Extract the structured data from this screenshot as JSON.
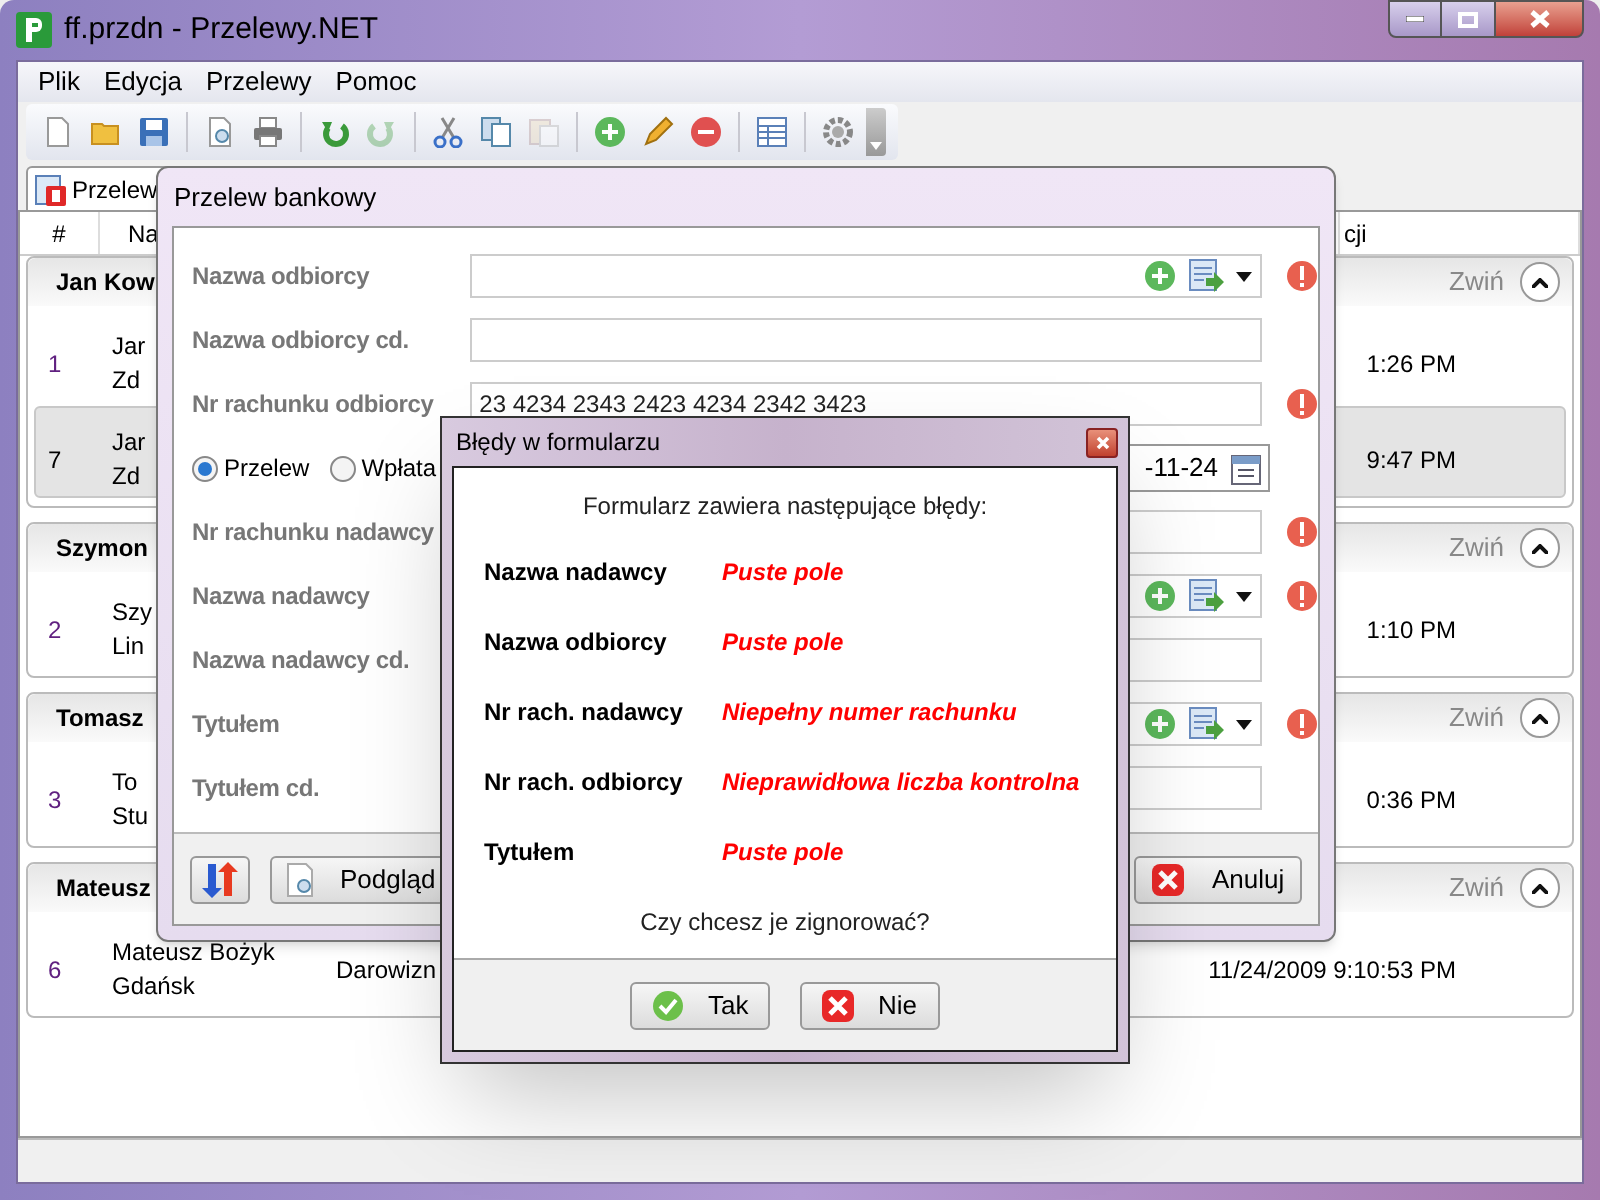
{
  "window": {
    "title": "ff.przdn - Przelewy.NET"
  },
  "menu": [
    "Plik",
    "Edycja",
    "Przelewy",
    "Pomoc"
  ],
  "toolbar": [
    [
      {
        "kind": "new",
        "disabled": false
      },
      {
        "kind": "open",
        "disabled": false
      },
      {
        "kind": "save",
        "disabled": false
      }
    ],
    [
      {
        "kind": "preview",
        "disabled": false
      },
      {
        "kind": "print",
        "disabled": false
      }
    ],
    [
      {
        "kind": "undo",
        "disabled": false
      },
      {
        "kind": "redo",
        "disabled": true
      }
    ],
    [
      {
        "kind": "cut",
        "disabled": false
      },
      {
        "kind": "copy",
        "disabled": false
      },
      {
        "kind": "paste",
        "disabled": true
      }
    ],
    [
      {
        "kind": "add",
        "disabled": false
      },
      {
        "kind": "edit",
        "disabled": false
      },
      {
        "kind": "remove",
        "disabled": false
      }
    ],
    [
      {
        "kind": "table",
        "disabled": false
      }
    ],
    [
      {
        "kind": "settings",
        "disabled": false
      }
    ]
  ],
  "tabs": [
    {
      "label": "Przelew",
      "selected": true
    }
  ],
  "list": {
    "columns": [
      "#",
      "Na",
      "cji"
    ],
    "groups": [
      {
        "header": "Jan Kow",
        "collapse_label": "Zwiń",
        "rows": [
          {
            "number": "1",
            "name": "Jar",
            "city": "Zd",
            "time": "1:26 PM",
            "selected": false
          },
          {
            "number": "7",
            "name": "Jar",
            "city": "Zd",
            "time": "9:47 PM",
            "selected": true
          }
        ]
      },
      {
        "header": "Szymon",
        "collapse_label": "Zwiń",
        "rows": [
          {
            "number": "2",
            "name": "Szy",
            "city": "Lin",
            "time": "1:10 PM",
            "selected": false
          }
        ]
      },
      {
        "header": "Tomasz",
        "collapse_label": "Zwiń",
        "rows": [
          {
            "number": "3",
            "name": "To",
            "city": "Stu",
            "time": "0:36 PM",
            "selected": false
          }
        ]
      },
      {
        "header": "Mateusz",
        "collapse_label": "Zwiń",
        "rows": [
          {
            "number": "6",
            "name": "Mateusz Bożyk",
            "city": "Gdańsk",
            "type": "Darowizn",
            "time": "11/24/2009 9:10:53 PM",
            "selected": false
          }
        ]
      }
    ]
  },
  "transfer_dialog": {
    "title": "Przelew bankowy",
    "fields_top": [
      {
        "label": "Nazwa odbiorcy",
        "kind": "combo",
        "error": true
      },
      {
        "label": "Nazwa odbiorcy cd.",
        "kind": "text",
        "error": false
      },
      {
        "label": "Nr rachunku odbiorcy",
        "kind": "text",
        "value": "23 4234 2343 2423 4234 2342 3423",
        "error": true
      }
    ],
    "payment_type": [
      {
        "label": "Przelew",
        "selected": true
      },
      {
        "label": "Wpłata",
        "selected": false
      }
    ],
    "date": "-11-24",
    "fields_bottom": [
      {
        "label": "Nr rachunku nadawcy",
        "kind": "text",
        "error": true
      },
      {
        "label": "Nazwa nadawcy",
        "kind": "combo",
        "error": true
      },
      {
        "label": "Nazwa nadawcy cd.",
        "kind": "text",
        "error": false
      },
      {
        "label": "Tytułem",
        "kind": "combo",
        "error": true
      },
      {
        "label": "Tytułem cd.",
        "kind": "text",
        "error": false
      }
    ],
    "buttons": [
      {
        "kind": "swap"
      },
      {
        "kind": "preview",
        "label": "Podgląd"
      },
      {
        "kind": "cancel",
        "label": "Anuluj"
      }
    ]
  },
  "error_dialog": {
    "title": "Błędy w formularzu",
    "intro": "Formularz zawiera następujące błędy:",
    "errors": [
      {
        "field": "Nazwa nadawcy",
        "message": "Puste pole"
      },
      {
        "field": "Nazwa odbiorcy",
        "message": "Puste pole"
      },
      {
        "field": "Nr rach. nadawcy",
        "message": "Niepełny numer rachunku"
      },
      {
        "field": "Nr rach. odbiorcy",
        "message": "Nieprawidłowa liczba kontrolna"
      },
      {
        "field": "Tytułem",
        "message": "Puste pole"
      }
    ],
    "question": "Czy chcesz je zignorować?",
    "buttons": [
      {
        "kind": "yes",
        "label": "Tak"
      },
      {
        "kind": "no",
        "label": "Nie"
      }
    ]
  }
}
